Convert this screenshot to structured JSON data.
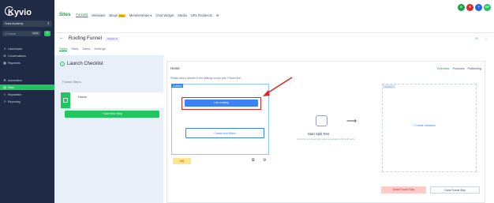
{
  "app": {
    "logo_text": "Kyvio"
  },
  "sidebar": {
    "account": "Grant Academy",
    "search_placeholder": "Q Search",
    "search_kbd": "ctrl K",
    "add_label": "+",
    "items": [
      {
        "label": "Launchpad",
        "icon": "rocket-icon",
        "glyph": "➚"
      },
      {
        "label": "Conversations",
        "icon": "chat-icon",
        "glyph": "✉"
      },
      {
        "label": "Payments",
        "icon": "payments-icon",
        "glyph": "▦"
      },
      {
        "label": "Automation",
        "icon": "automation-icon",
        "glyph": "⚙"
      },
      {
        "label": "Sites",
        "icon": "sites-icon",
        "glyph": "▤"
      },
      {
        "label": "Reputation",
        "icon": "star-icon",
        "glyph": "✩"
      },
      {
        "label": "Reporting",
        "icon": "reporting-icon",
        "glyph": "↗"
      }
    ]
  },
  "topbar": {
    "section": "Sites",
    "tabs": [
      "Funnels",
      "Websites",
      "Blogs",
      "Memberships",
      "Chat Widget",
      "Media",
      "URL Redirects"
    ],
    "blogs_badge": "New",
    "avatars": [
      {
        "label": "G",
        "color": "#16a34a"
      },
      {
        "label": "R",
        "color": "#dc2626"
      },
      {
        "label": "?",
        "color": "#2563eb"
      },
      {
        "label": "GP",
        "color": "#22c55e"
      }
    ]
  },
  "funnel": {
    "title": "Roofing Funnel",
    "version": "Version 2",
    "subtabs": [
      "Steps",
      "Stats",
      "Sales",
      "Settings"
    ]
  },
  "left_panel": {
    "checklist": "Launch Checklist",
    "steps_label": "Funnel Steps",
    "step_name": "Home",
    "add_step": "+ Add New Step"
  },
  "right_panel": {
    "page_name": "Home",
    "tabs": [
      "Overview",
      "Products",
      "Publishing"
    ],
    "hint": "Please add a domain in the settings to see your Funnel live!",
    "control_label": "Control",
    "use_existing": "Use existing",
    "create_blank": "Create from Blank",
    "ab_label": "A/B",
    "split_title": "Start Split Test",
    "split_subtitle": "Optimize your lead and sales generation with split tests",
    "variation_tag": "Variation",
    "create_variation": "+ Create Variation",
    "delete_step": "Delete Funnel Step",
    "clone_step": "Clone Funnel Step"
  },
  "colors": {
    "accent": "#22c55e",
    "primary": "#3b82f6",
    "annotation": "#dc2626",
    "sidebar_bg": "#1f2a44"
  }
}
